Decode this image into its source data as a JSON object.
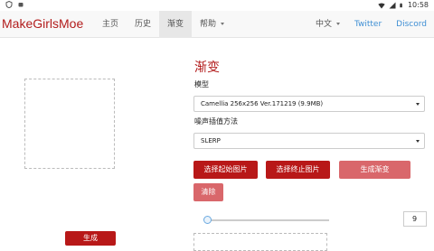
{
  "status": {
    "time": "10:58"
  },
  "nav": {
    "brand": "MakeGirlsMoe",
    "items": [
      "主页",
      "历史",
      "渐变",
      "帮助"
    ],
    "language": "中文",
    "twitter": "Twitter",
    "discord": "Discord"
  },
  "left": {
    "generate_label": "生成"
  },
  "main": {
    "title": "渐变",
    "model_label": "模型",
    "model_value": "Camellia 256x256 Ver.171219 (9.9MB)",
    "noise_label": "噪声插值方法",
    "noise_value": "SLERP",
    "btn_select_start": "选择起始图片",
    "btn_select_end": "选择终止图片",
    "btn_generate_gradient": "生成渐变",
    "btn_clear": "清除",
    "slider_level": 0.0,
    "number_value": "9"
  }
}
